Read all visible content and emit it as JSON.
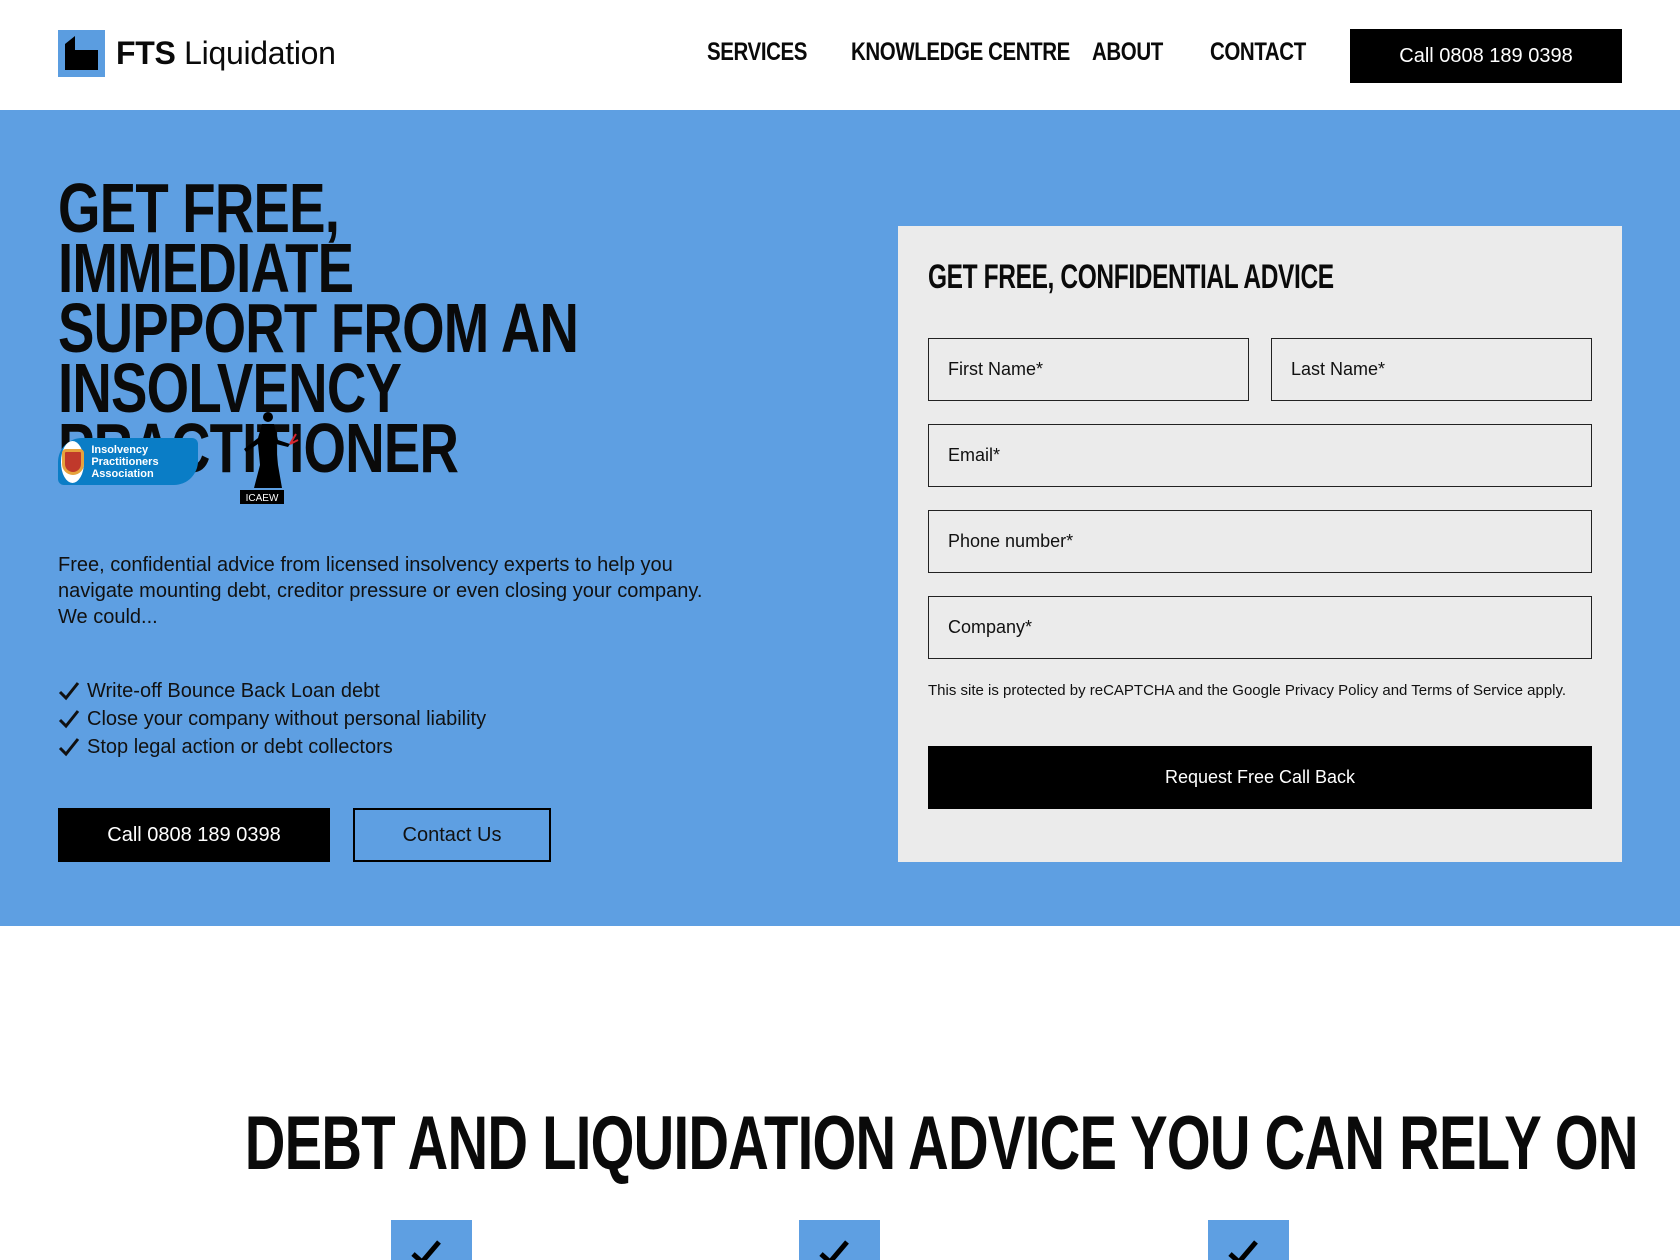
{
  "brand": {
    "name_bold": "FTS",
    "name_light": "Liquidation",
    "accent": "#5e9fe2"
  },
  "nav": {
    "items": [
      {
        "label": "SERVICES"
      },
      {
        "label": "KNOWLEDGE CENTRE"
      },
      {
        "label": "ABOUT"
      },
      {
        "label": "CONTACT"
      }
    ],
    "call_label": "Call 0808 189 0398"
  },
  "hero": {
    "title_lines": [
      "GET FREE, IMMEDIATE",
      "SUPPORT FROM AN",
      "INSOLVENCY PRACTITIONER"
    ],
    "badge_ipa": "Insolvency Practitioners Association",
    "badge_icaew": "ICAEW",
    "description": "Free, confidential advice from licensed insolvency experts to help you navigate mounting debt, creditor pressure or even closing your company. We could...",
    "checklist": [
      "Write-off Bounce Back Loan debt",
      "Close your company without personal liability",
      "Stop legal action or debt collectors"
    ],
    "call_button": "Call 0808 189 0398",
    "contact_button": "Contact Us"
  },
  "form": {
    "title": "GET FREE, CONFIDENTIAL ADVICE",
    "first_name_placeholder": "First Name*",
    "last_name_placeholder": "Last Name*",
    "email_placeholder": "Email*",
    "phone_placeholder": "Phone number*",
    "company_placeholder": "Company*",
    "recaptcha_text": "This site is protected by reCAPTCHA and the Google Privacy Policy and Terms of Service apply.",
    "submit_label": "Request Free Call Back"
  },
  "section": {
    "title": "DEBT AND LIQUIDATION ADVICE YOU CAN RELY ON"
  }
}
